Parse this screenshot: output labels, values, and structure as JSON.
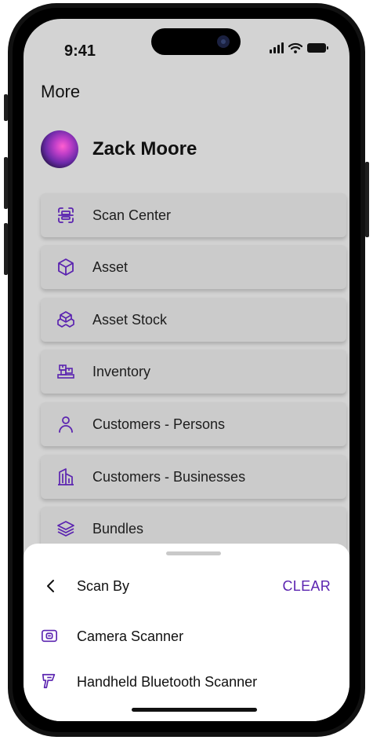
{
  "status_bar": {
    "time": "9:41"
  },
  "page": {
    "title": "More"
  },
  "user": {
    "name": "Zack Moore"
  },
  "menu": {
    "items": [
      {
        "label": "Scan Center",
        "icon": "scan-icon"
      },
      {
        "label": "Asset",
        "icon": "cube-icon"
      },
      {
        "label": "Asset Stock",
        "icon": "boxes-icon"
      },
      {
        "label": "Inventory",
        "icon": "inventory-icon"
      },
      {
        "label": "Customers - Persons",
        "icon": "person-icon"
      },
      {
        "label": "Customers - Businesses",
        "icon": "building-icon"
      },
      {
        "label": "Bundles",
        "icon": "layers-icon"
      }
    ]
  },
  "sheet": {
    "title": "Scan By",
    "clear_label": "CLEAR",
    "options": [
      {
        "label": "Camera Scanner",
        "icon": "camera-icon"
      },
      {
        "label": "Handheld Bluetooth Scanner",
        "icon": "barcode-scanner-icon"
      }
    ]
  },
  "colors": {
    "accent": "#5b24b0",
    "icon": "#5b24b0",
    "overlay_bg": "#d3d3d3",
    "card_bg": "#cbcbcb"
  }
}
